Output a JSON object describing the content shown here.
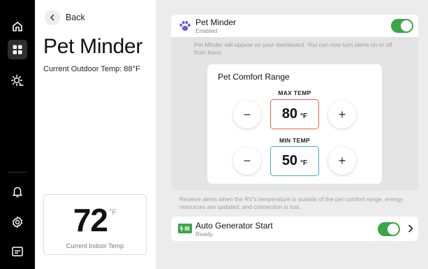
{
  "nav": {
    "items": [
      {
        "icon": "home-icon"
      },
      {
        "icon": "dashboard-grid-icon",
        "active": true
      },
      {
        "icon": "sun-weather-icon"
      },
      {
        "icon": "bell-icon"
      },
      {
        "icon": "gear-icon"
      },
      {
        "icon": "display-panel-icon"
      }
    ]
  },
  "left_panel": {
    "back_label": "Back",
    "title": "Pet Minder",
    "outdoor_temp": "Current Outdoor Temp: 88°F",
    "indoor": {
      "value": "72",
      "unit": "°F",
      "label": "Current Indoor Temp"
    }
  },
  "pet_minder": {
    "name": "Pet Minder",
    "status": "Enabled",
    "enabled": true,
    "description": "Pet Minder will appear on your dashboard. You can now turn alerts on or off from there.",
    "range": {
      "title": "Pet Comfort Range",
      "max": {
        "label": "MAX TEMP",
        "value": "80",
        "unit": "°F",
        "border_color": "#e0654a"
      },
      "min": {
        "label": "MIN TEMP",
        "value": "50",
        "unit": "°F",
        "border_color": "#3fa9c9"
      },
      "decrease_symbol": "−",
      "increase_symbol": "+"
    }
  },
  "alert_description": "Receive alerts when the RV's temperature is outside of the pet comfort range, energy resources are updated, and connection is lost.",
  "generator": {
    "name": "Auto Generator Start",
    "status": "Ready",
    "enabled": true
  },
  "colors": {
    "accent_green": "#3aa647",
    "paw_purple": "#6b5ccf",
    "rail": "#000000"
  }
}
